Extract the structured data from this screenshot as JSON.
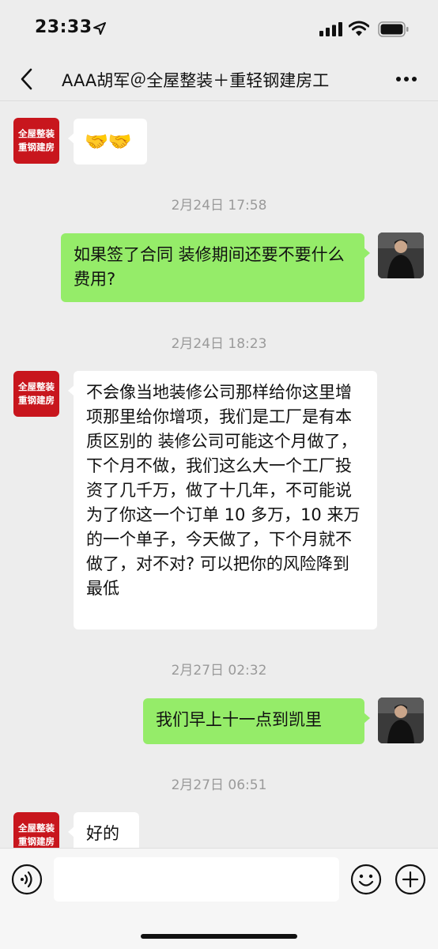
{
  "status_bar": {
    "time": "23:33"
  },
  "nav": {
    "title": "AAA胡军＠全屋整装＋重轻钢建房工"
  },
  "contact_avatar": {
    "line1": "全屋整装",
    "line2": "重钢建房"
  },
  "messages": [
    {
      "text": "🤝🤝"
    },
    {
      "text": "2月24日 17:58"
    },
    {
      "text": "如果签了合同 装修期间还要不要什么费用?"
    },
    {
      "text": "2月24日 18:23"
    },
    {
      "text": "不会像当地装修公司那样给你这里增项那里给你增项，我们是工厂是有本质区别的 装修公司可能这个月做了，下个月不做，我们这么大一个工厂投资了几千万，做了十几年，不可能说为了你这一个订单 10 多万，10 来万的一个单子，今天做了，下个月就不做了，对不对? 可以把你的风险降到最低"
    },
    {
      "text": "2月27日 02:32"
    },
    {
      "text": "我们早上十一点到凯里"
    },
    {
      "text": "2月27日 06:51"
    },
    {
      "text": "好的"
    }
  ],
  "input": {
    "value": ""
  },
  "colors": {
    "outgoing_bubble": "#95ec69",
    "incoming_bubble": "#ffffff",
    "background": "#ededed",
    "brand_red": "#c8161d"
  },
  "icons": [
    "location-arrow-icon",
    "signal-icon",
    "wifi-icon",
    "battery-icon",
    "back-chevron-icon",
    "more-dots-icon",
    "voice-icon",
    "emoji-icon",
    "plus-icon"
  ]
}
